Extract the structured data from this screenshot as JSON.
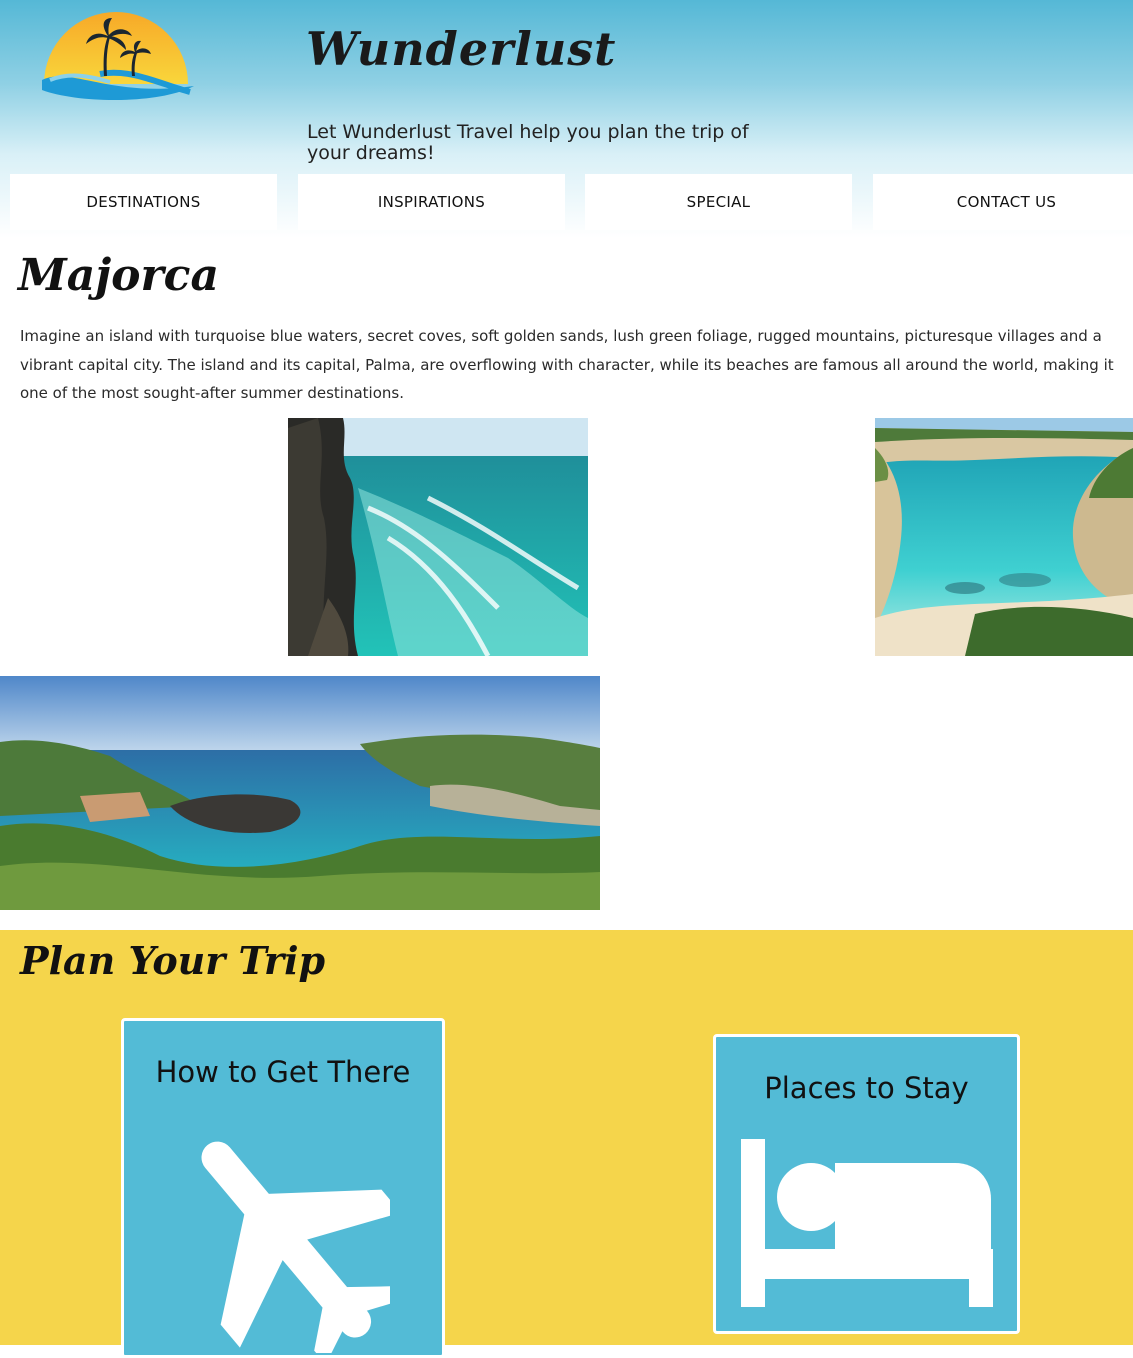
{
  "brand": {
    "name": "Wunderlust",
    "tagline": "Let Wunderlust Travel help you plan the trip of your dreams!"
  },
  "nav": {
    "items": [
      {
        "label": "DESTINATIONS"
      },
      {
        "label": "INSPIRATIONS"
      },
      {
        "label": "SPECIAL"
      },
      {
        "label": "CONTACT US"
      }
    ]
  },
  "destination": {
    "title": "Majorca",
    "description": "Imagine an island with turquoise blue waters, secret coves, soft golden sands, lush green foliage, rugged mountains, picturesque villages and a vibrant capital city. The island and its capital, Palma, are overflowing with character, while its beaches are famous all around the world, making it one of the most sought-after summer destinations."
  },
  "plan": {
    "title": "Plan Your Trip",
    "cards": [
      {
        "title": "How to Get There",
        "icon": "airplane-icon"
      },
      {
        "title": "Places to Stay",
        "icon": "bed-icon"
      }
    ]
  },
  "colors": {
    "sky": "#55b8d6",
    "plan_bg": "#f5d54b",
    "card_bg": "#53bbd6"
  }
}
